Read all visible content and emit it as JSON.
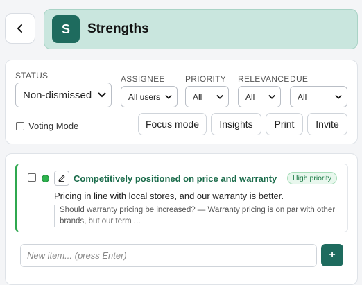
{
  "header": {
    "avatar_letter": "S",
    "title": "Strengths",
    "accent": "#1e6b5e"
  },
  "filters": {
    "status": {
      "label": "STATUS",
      "value": "Non-dismissed"
    },
    "assignee": {
      "label": "ASSIGNEE",
      "value": "All users"
    },
    "priority": {
      "label": "PRIORITY",
      "value": "All"
    },
    "relevance": {
      "label": "RELEVANCE",
      "value": "All"
    },
    "due": {
      "label": "DUE",
      "value": "All"
    },
    "voting_mode": "Voting Mode",
    "buttons": {
      "focus": "Focus mode",
      "insights": "Insights",
      "print": "Print",
      "invite": "Invite"
    }
  },
  "items": [
    {
      "title": "Competitively positioned on price and warranty",
      "badge": "High priority",
      "description": "Pricing in line with local stores, and our warranty is better.",
      "comment": "Should warranty pricing be increased? — Warranty pricing is on par with other brands, but our term ...",
      "status_color": "#2fb34f"
    }
  ],
  "new_item": {
    "placeholder": "New item... (press Enter)",
    "add_label": "+"
  }
}
